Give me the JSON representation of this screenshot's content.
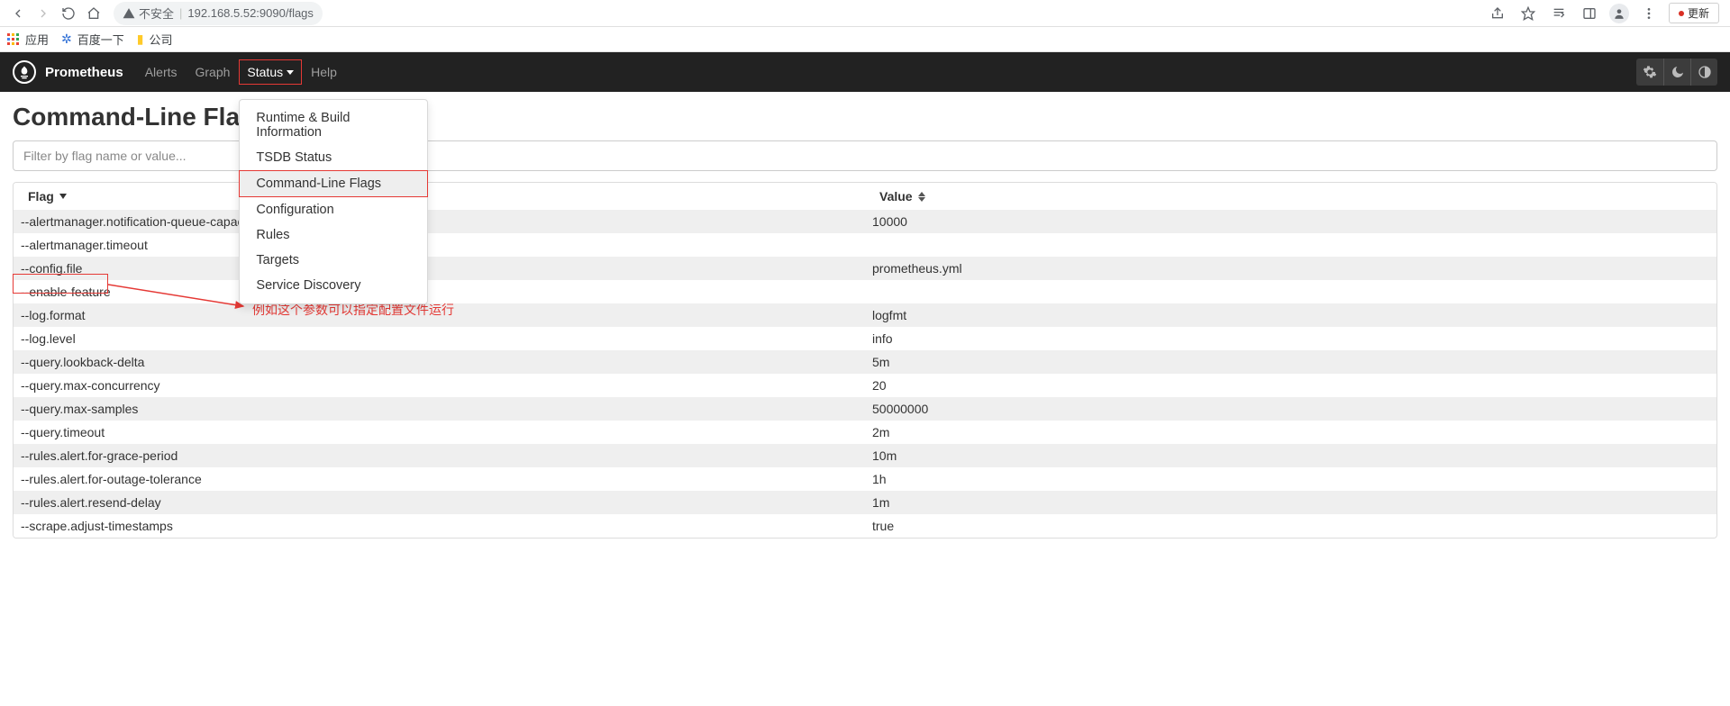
{
  "browser": {
    "insecure_label": "不安全",
    "url": "192.168.5.52:9090/flags",
    "update_label": "更新"
  },
  "bookmarks": {
    "apps": "应用",
    "baidu": "百度一下",
    "company": "公司"
  },
  "nav": {
    "brand": "Prometheus",
    "alerts": "Alerts",
    "graph": "Graph",
    "status": "Status",
    "help": "Help"
  },
  "status_menu": {
    "runtime": "Runtime & Build Information",
    "tsdb": "TSDB Status",
    "flags": "Command-Line Flags",
    "config": "Configuration",
    "rules": "Rules",
    "targets": "Targets",
    "sd": "Service Discovery"
  },
  "page": {
    "title": "Command-Line Flags",
    "filter_placeholder": "Filter by flag name or value...",
    "col_flag": "Flag",
    "col_value": "Value"
  },
  "annotation": {
    "text": "例如这个参数可以指定配置文件运行"
  },
  "flags": [
    {
      "flag": "--alertmanager.notification-queue-capacity",
      "value": "10000"
    },
    {
      "flag": "--alertmanager.timeout",
      "value": ""
    },
    {
      "flag": "--config.file",
      "value": "prometheus.yml"
    },
    {
      "flag": "--enable-feature",
      "value": ""
    },
    {
      "flag": "--log.format",
      "value": "logfmt"
    },
    {
      "flag": "--log.level",
      "value": "info"
    },
    {
      "flag": "--query.lookback-delta",
      "value": "5m"
    },
    {
      "flag": "--query.max-concurrency",
      "value": "20"
    },
    {
      "flag": "--query.max-samples",
      "value": "50000000"
    },
    {
      "flag": "--query.timeout",
      "value": "2m"
    },
    {
      "flag": "--rules.alert.for-grace-period",
      "value": "10m"
    },
    {
      "flag": "--rules.alert.for-outage-tolerance",
      "value": "1h"
    },
    {
      "flag": "--rules.alert.resend-delay",
      "value": "1m"
    },
    {
      "flag": "--scrape.adjust-timestamps",
      "value": "true"
    }
  ]
}
